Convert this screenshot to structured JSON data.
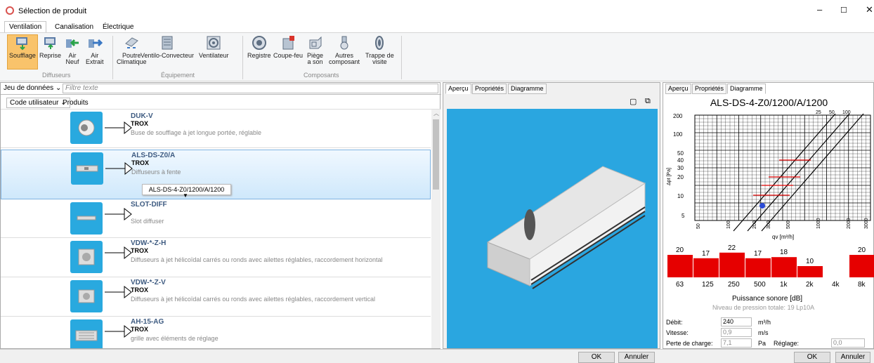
{
  "window": {
    "title": "Sélection de produit",
    "minimize": "–",
    "maximize": "☐",
    "close": "✕"
  },
  "ribbon": {
    "tabs": [
      "Ventilation",
      "Canalisation",
      "Électrique"
    ],
    "buttons": [
      {
        "label": "Soufflage",
        "icon": "supply-air-icon"
      },
      {
        "label": "Reprise",
        "icon": "return-air-icon"
      },
      {
        "label": "Air\nNeuf",
        "icon": "fresh-air-icon"
      },
      {
        "label": "Air\nExtrait",
        "icon": "exhaust-air-icon"
      },
      {
        "label": "Poutre\nClimatique",
        "icon": "chilled-beam-icon"
      },
      {
        "label": "Ventilo-Convecteur",
        "icon": "fan-coil-icon"
      },
      {
        "label": "Ventilateur",
        "icon": "fan-icon"
      },
      {
        "label": "Registre",
        "icon": "damper-icon"
      },
      {
        "label": "Coupe-feu",
        "icon": "fire-damper-icon"
      },
      {
        "label": "Piège\na son",
        "icon": "silencer-icon"
      },
      {
        "label": "Autres\ncomposant",
        "icon": "other-component-icon"
      },
      {
        "label": "Trappe de\nvisite",
        "icon": "access-door-icon"
      }
    ],
    "groups": [
      "Diffuseurs",
      "Équipement",
      "Composants"
    ]
  },
  "filter": {
    "dataset": "Jeu de données",
    "placeholder": "Filtre texte",
    "code": "Code utilisateur",
    "products": "Produits"
  },
  "products": [
    {
      "name": "DUK-V",
      "brand": "TROX",
      "desc": "Buse de soufflage à jet longue portée, réglable"
    },
    {
      "name": "ALS-DS-Z0/A",
      "brand": "TROX",
      "desc": "Diffuseurs à fente",
      "variant": "ALS-DS-4-Z0/1200/A/1200"
    },
    {
      "name": "SLOT-DIFF",
      "brand": "",
      "desc": "Slot diffuser"
    },
    {
      "name": "VDW-*-Z-H",
      "brand": "TROX",
      "desc": "Diffuseurs à jet hélicoïdal carrés ou ronds avec ailettes réglables, raccordement horizontal"
    },
    {
      "name": "VDW-*-Z-V",
      "brand": "TROX",
      "desc": "Diffuseurs à jet hélicoïdal carrés ou ronds avec ailettes réglables, raccordement vertical"
    },
    {
      "name": "AH-15-AG",
      "brand": "TROX",
      "desc": "grille avec éléments de réglage"
    }
  ],
  "midpane": {
    "tabs": [
      "Aperçu",
      "Propriétés",
      "Diagramme"
    ]
  },
  "rightpane": {
    "tabs": [
      "Aperçu",
      "Propriétés",
      "Diagramme"
    ],
    "title": "ALS-DS-4-Z0/1200/A/1200",
    "xaxis": "qv [m³/h]",
    "yaxis": "Δpt [Pa]",
    "yticks": [
      "200",
      "100",
      "50",
      "40",
      "30",
      "20",
      "10",
      "5"
    ],
    "xticks": [
      "50",
      "100",
      "200",
      "300",
      "500",
      "1000",
      "2000",
      "3000"
    ],
    "topticks": [
      "25",
      "50",
      "100"
    ],
    "sound_values": [
      "20",
      "17",
      "22",
      "17",
      "18",
      "10",
      "",
      "20"
    ],
    "sound_bands": [
      "63",
      "125",
      "250",
      "500",
      "1k",
      "2k",
      "4k",
      "8k"
    ],
    "sound_label": "Puissance sonore [dB]",
    "pressure_total": "Niveau de pression totale: 19 Lp10A",
    "debit_label": "Débit:",
    "debit_value": "240",
    "debit_unit": "m³/h",
    "vitesse_label": "Vitesse:",
    "vitesse_value": "0,9",
    "vitesse_unit": "m/s",
    "perte_label": "Perte de charge:",
    "perte_value": "7,1",
    "perte_unit": "Pa",
    "reglage_label": "Réglage:",
    "reglage_value": "0,0"
  },
  "bottom": {
    "ok": "OK",
    "cancel": "Annuler"
  },
  "colors": {
    "accent": "#2aa6e0",
    "bar": "#e60000",
    "selected": "#f9c36b"
  }
}
